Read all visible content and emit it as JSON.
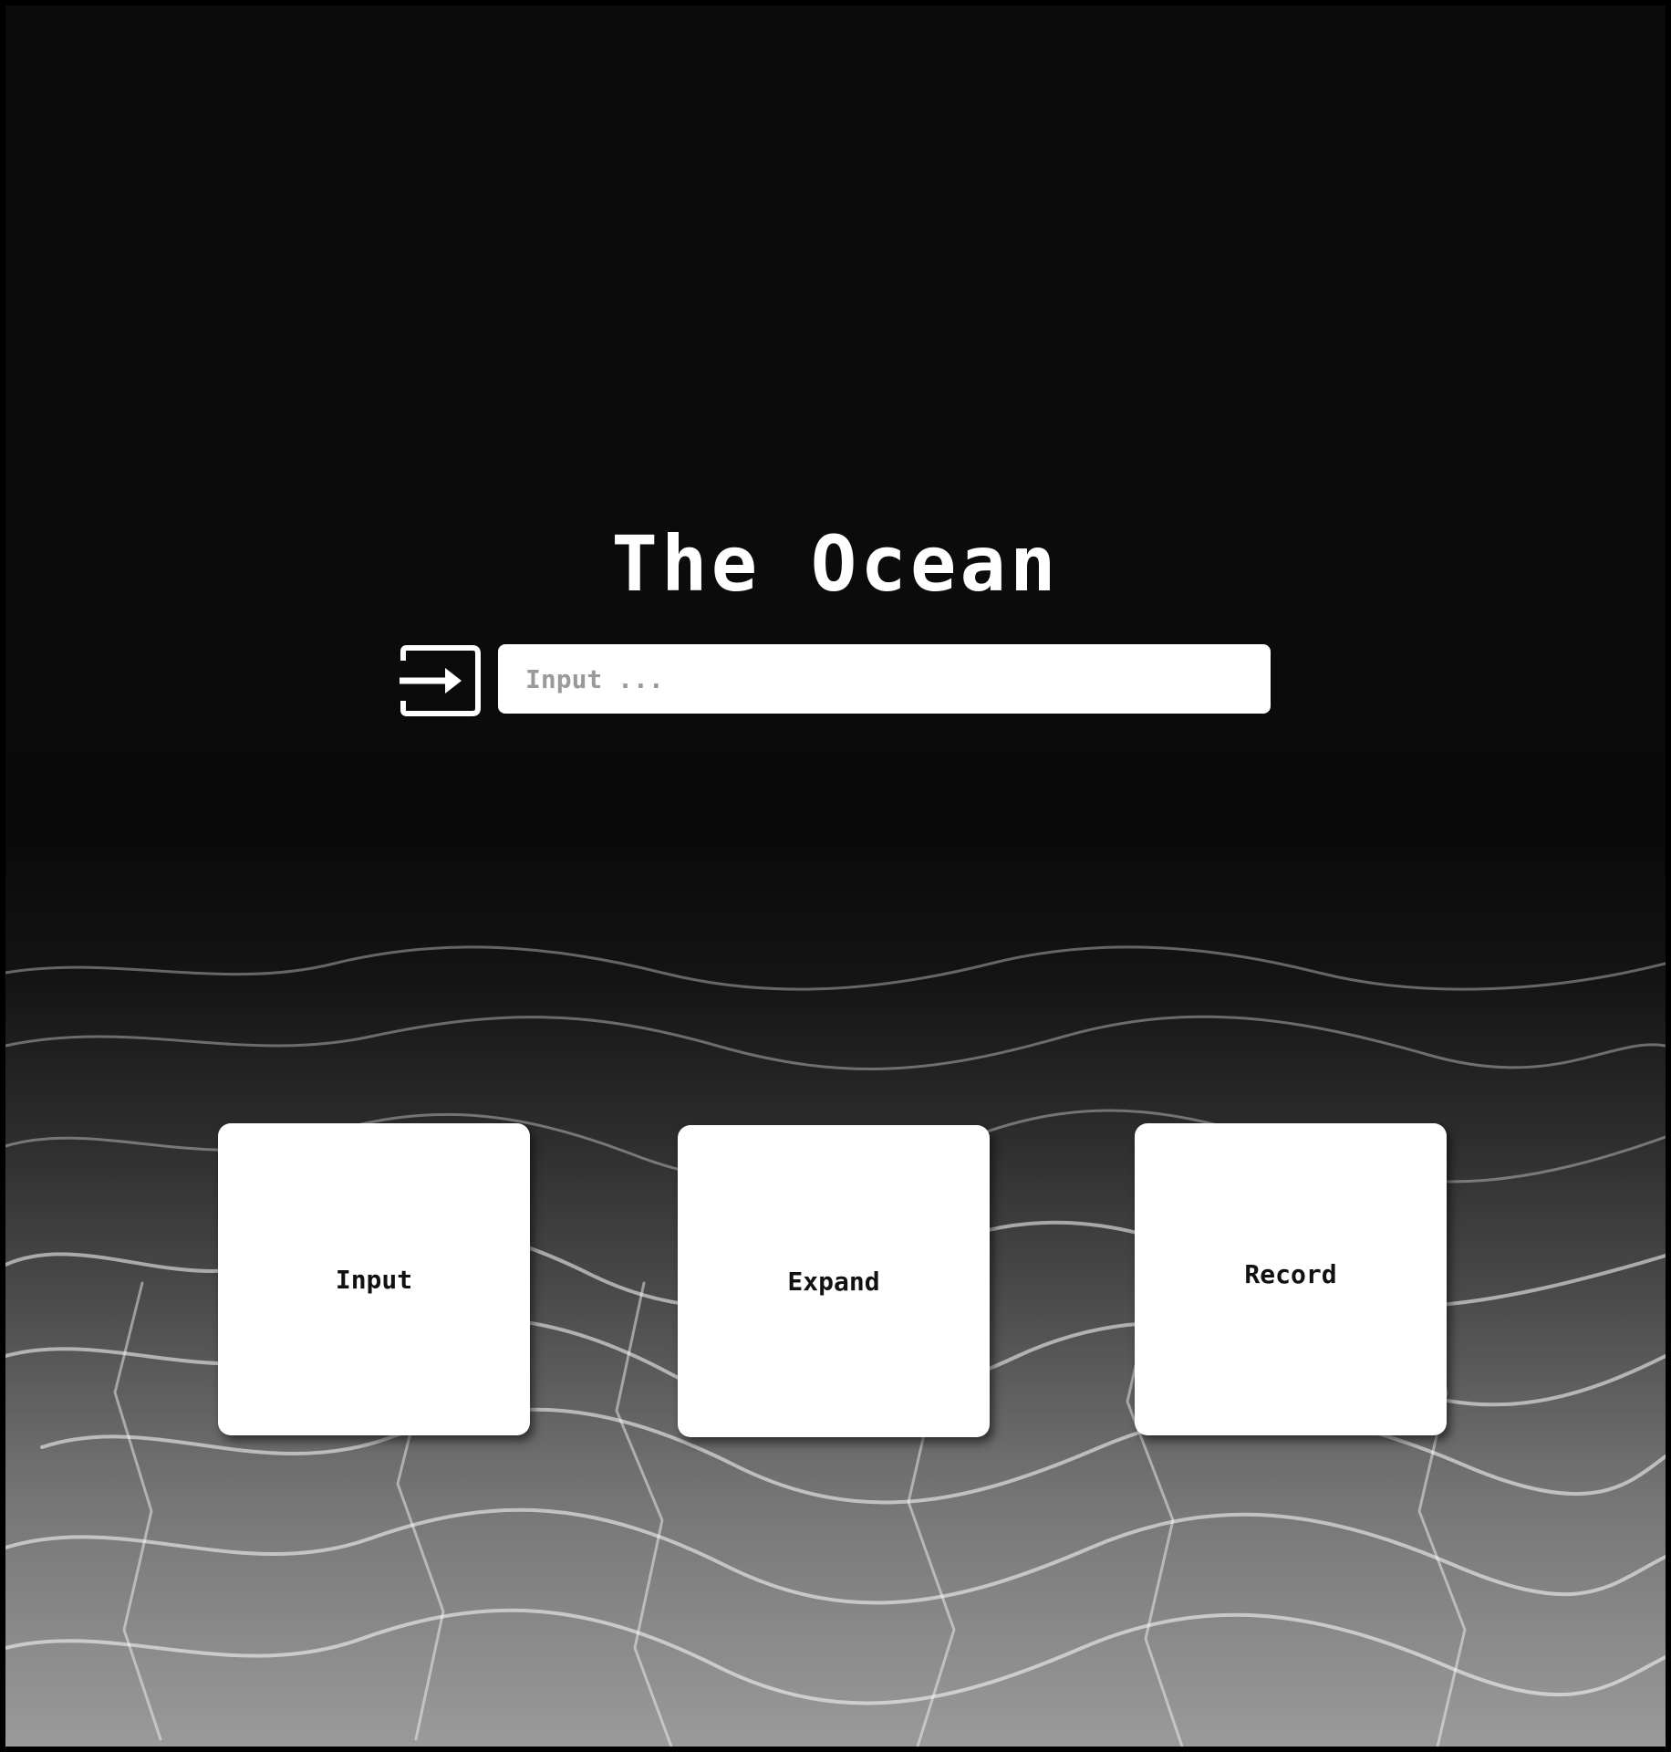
{
  "page": {
    "title": "The Ocean"
  },
  "search": {
    "placeholder": "Input ...",
    "value": ""
  },
  "icons": {
    "submit": "login-arrow-icon"
  },
  "cards": [
    {
      "label": "Input"
    },
    {
      "label": "Expand"
    },
    {
      "label": "Record"
    }
  ],
  "colors": {
    "background_top": "#0b0b0c",
    "background_bottom": "#9a9a9a",
    "card": "#ffffff",
    "text_on_dark": "#ffffff",
    "text_on_card": "#111111",
    "placeholder": "#9a9a9a"
  }
}
